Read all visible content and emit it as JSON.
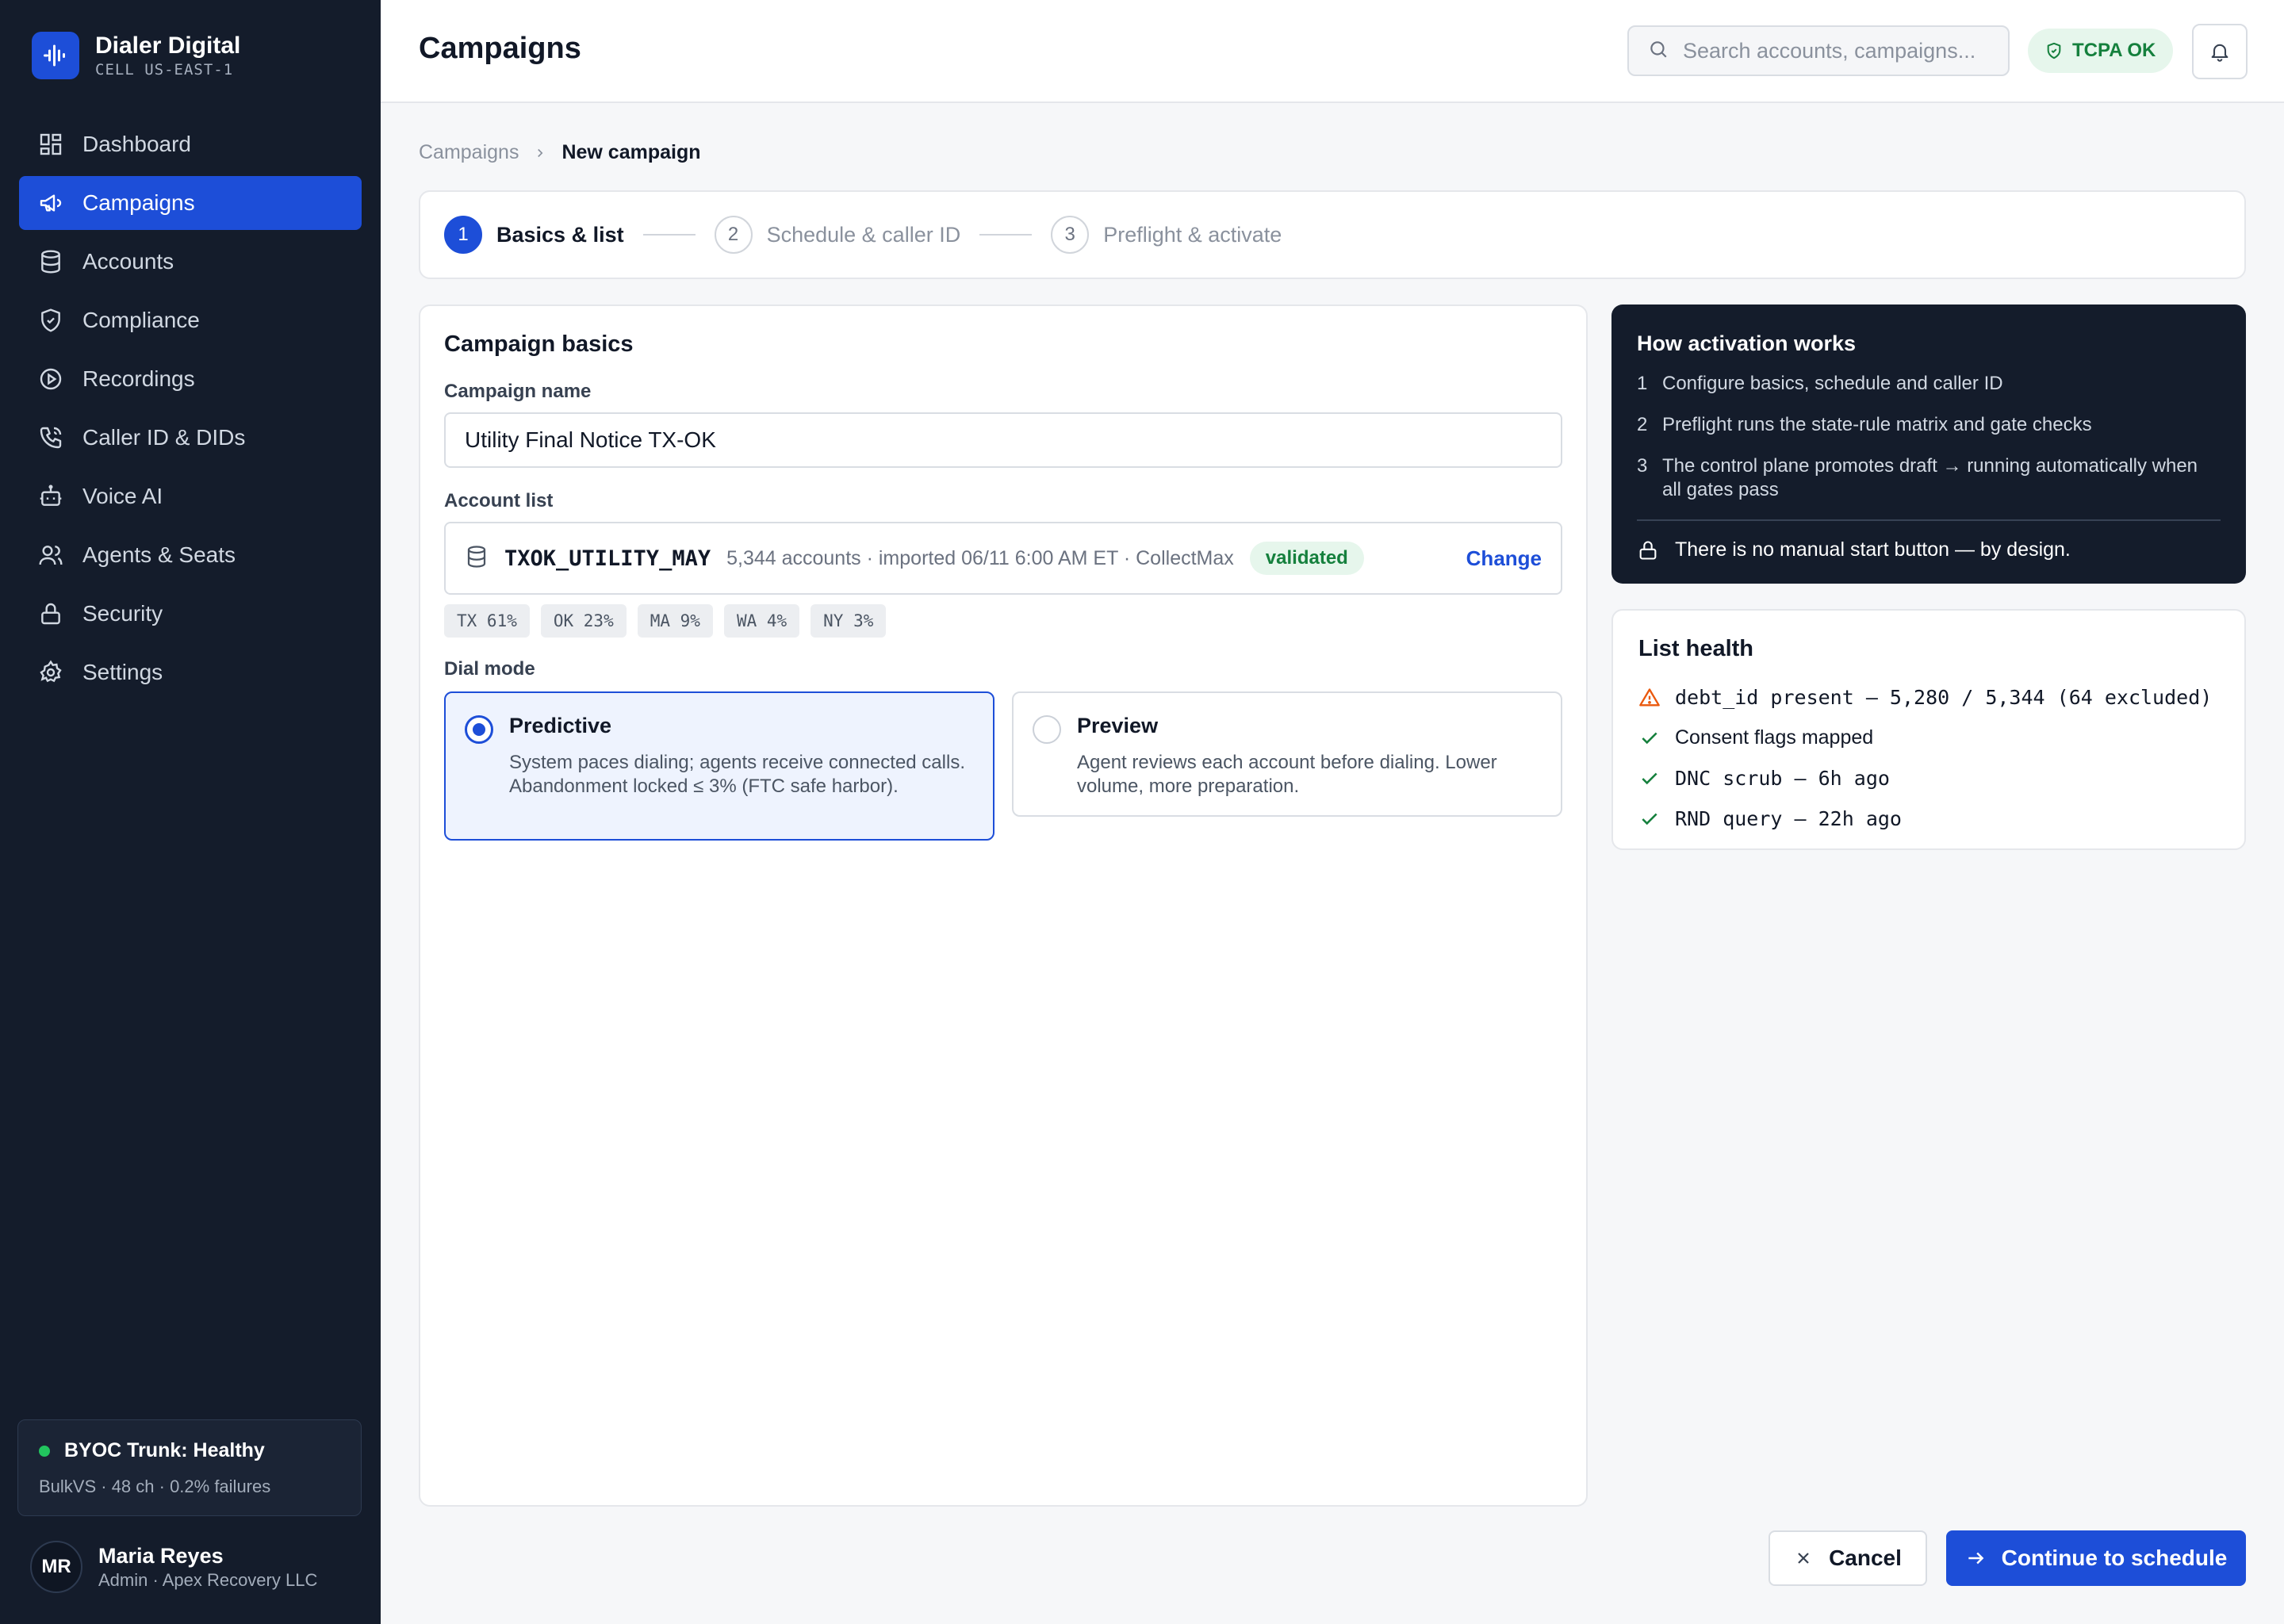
{
  "brand": {
    "name": "Dialer Digital",
    "cell": "CELL US-EAST-1"
  },
  "sidebar": {
    "items": [
      {
        "label": "Dashboard",
        "icon": "grid-icon",
        "active": false
      },
      {
        "label": "Campaigns",
        "icon": "megaphone-icon",
        "active": true
      },
      {
        "label": "Accounts",
        "icon": "database-icon",
        "active": false
      },
      {
        "label": "Compliance",
        "icon": "shield-check-icon",
        "active": false
      },
      {
        "label": "Recordings",
        "icon": "play-circle-icon",
        "active": false
      },
      {
        "label": "Caller ID & DIDs",
        "icon": "phone-icon",
        "active": false
      },
      {
        "label": "Voice AI",
        "icon": "bot-icon",
        "active": false
      },
      {
        "label": "Agents & Seats",
        "icon": "users-icon",
        "active": false
      },
      {
        "label": "Security",
        "icon": "lock-icon",
        "active": false
      },
      {
        "label": "Settings",
        "icon": "gear-icon",
        "active": false
      }
    ],
    "trunk": {
      "title": "BYOC Trunk: Healthy",
      "details": "BulkVS · 48 ch · 0.2% failures",
      "status_color": "#22c55e"
    },
    "user": {
      "initials": "MR",
      "name": "Maria Reyes",
      "role": "Admin · Apex Recovery LLC"
    }
  },
  "header": {
    "title": "Campaigns",
    "search_placeholder": "Search accounts, campaigns...",
    "search_value": "",
    "tcpa_badge": "TCPA OK"
  },
  "breadcrumb": {
    "parent": "Campaigns",
    "current": "New campaign"
  },
  "stepper": {
    "steps": [
      {
        "number": "1",
        "label": "Basics & list",
        "active": true
      },
      {
        "number": "2",
        "label": "Schedule & caller ID",
        "active": false
      },
      {
        "number": "3",
        "label": "Preflight & activate",
        "active": false
      }
    ]
  },
  "basics": {
    "title": "Campaign basics",
    "name_label": "Campaign name",
    "name_value": "Utility Final Notice TX-OK",
    "account_label": "Account list",
    "account": {
      "name": "TXOK_UTILITY_MAY",
      "meta": "5,344 accounts · imported 06/11 6:00 AM ET · CollectMax",
      "status": "validated",
      "change_label": "Change"
    },
    "states": [
      "TX 61%",
      "OK 23%",
      "MA 9%",
      "WA 4%",
      "NY 3%"
    ],
    "dial_mode_label": "Dial mode",
    "modes": [
      {
        "title": "Predictive",
        "desc": "System paces dialing; agents receive connected calls. Abandonment locked ≤ 3% (FTC safe harbor).",
        "selected": true
      },
      {
        "title": "Preview",
        "desc": "Agent reviews each account before dialing. Lower volume, more preparation.",
        "selected": false
      }
    ]
  },
  "activation": {
    "title": "How activation works",
    "steps": [
      {
        "n": "1",
        "text": "Configure basics, schedule and caller ID"
      },
      {
        "n": "2",
        "text": "Preflight runs the state-rule matrix and gate checks"
      },
      {
        "n": "3",
        "text": "The control plane promotes draft → running automatically when all gates pass"
      }
    ],
    "note": "There is no manual start button — by design."
  },
  "list_health": {
    "title": "List health",
    "items": [
      {
        "status": "warning",
        "text": "debt_id present — 5,280 / 5,344 (64 excluded)",
        "mono": true
      },
      {
        "status": "ok",
        "text": "Consent flags mapped",
        "mono": false
      },
      {
        "status": "ok",
        "text": "DNC scrub — 6h ago",
        "mono": true
      },
      {
        "status": "ok",
        "text": "RND query — 22h ago",
        "mono": true
      }
    ]
  },
  "actions": {
    "cancel": "Cancel",
    "continue": "Continue to schedule"
  },
  "colors": {
    "accent": "#1d4ed8",
    "sidebar_bg": "#141c2b",
    "success": "#15803d",
    "warning": "#ea580c"
  }
}
